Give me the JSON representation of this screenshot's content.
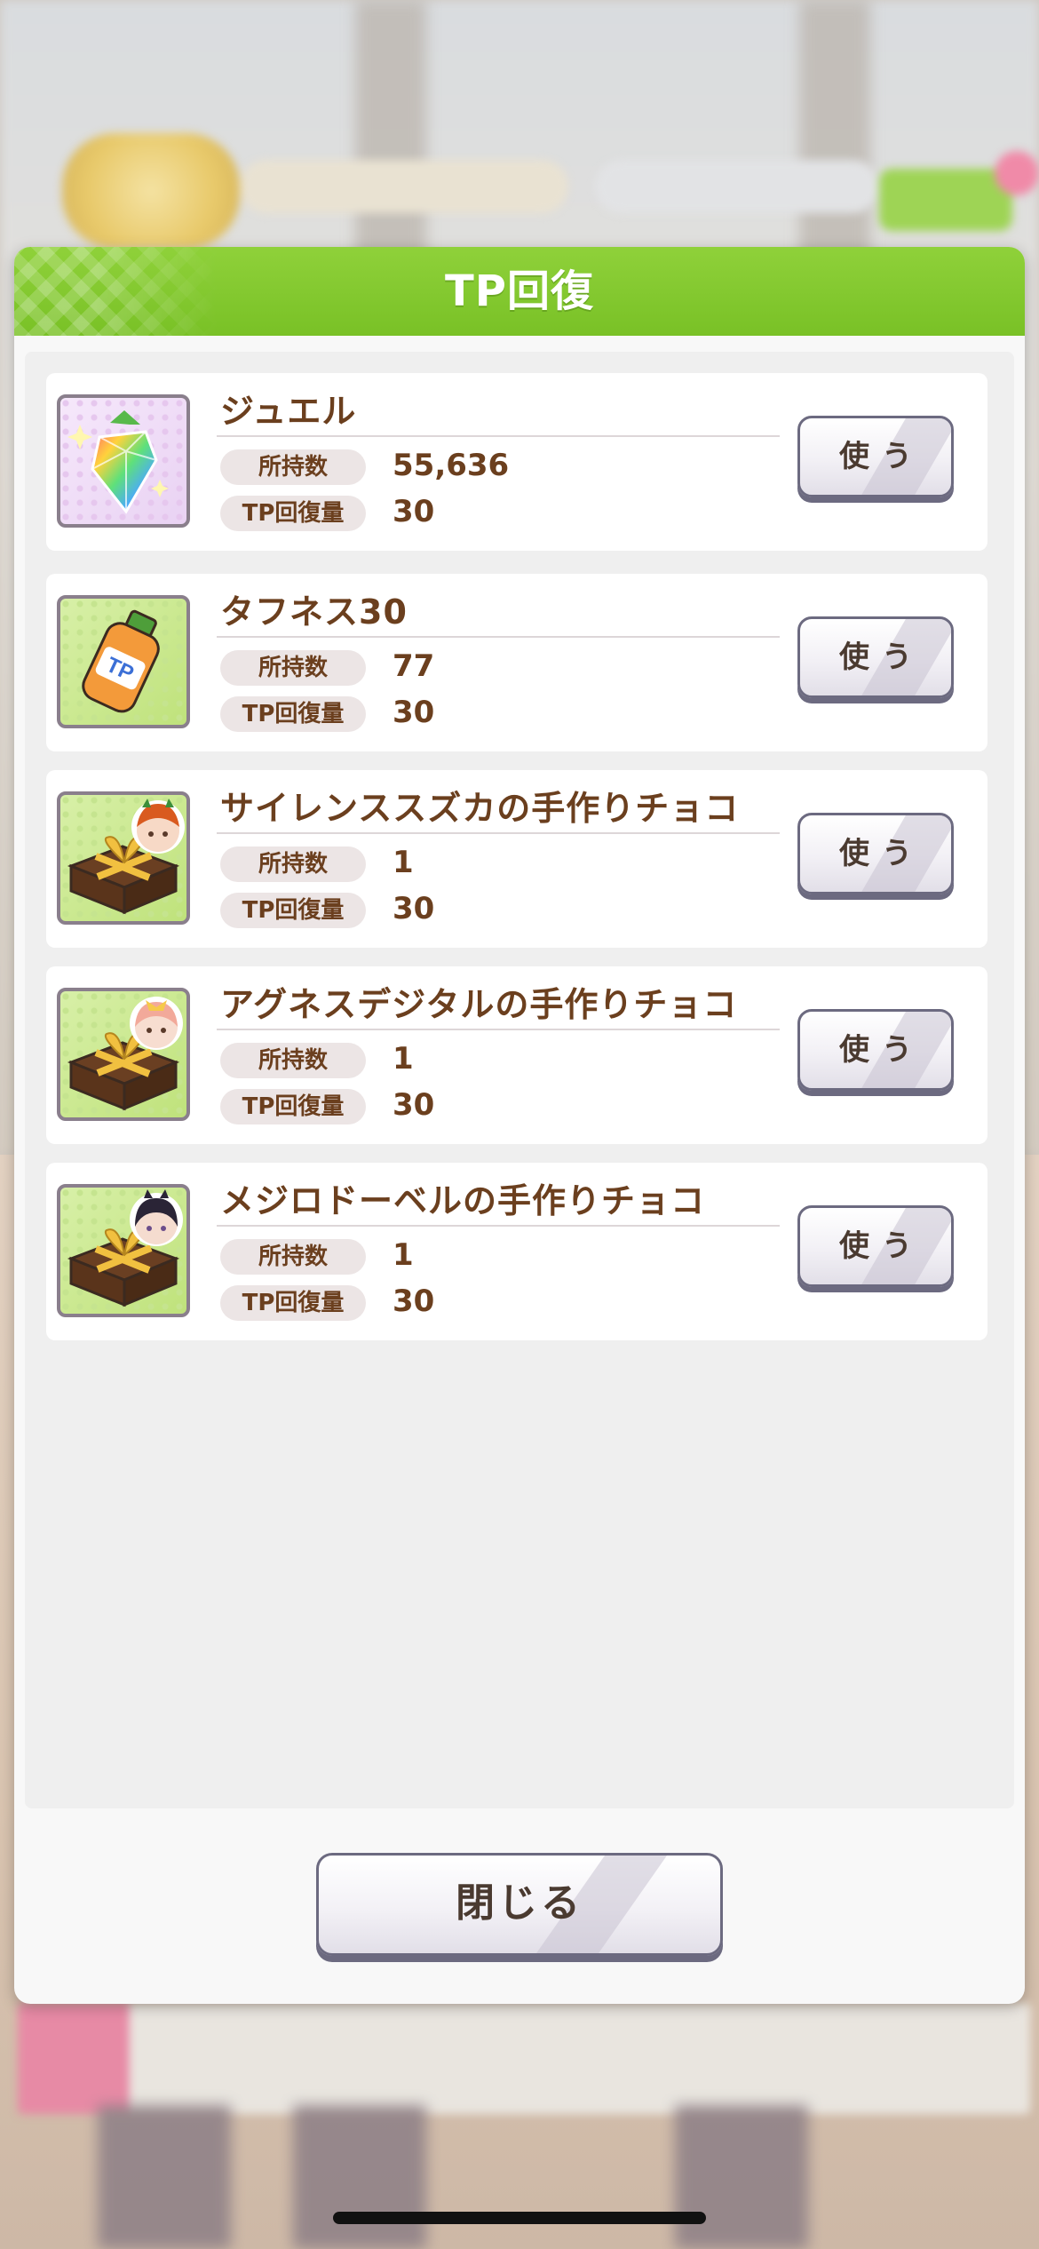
{
  "dialog": {
    "title": "TP回復",
    "close_label": "閉じる"
  },
  "labels": {
    "owned": "所持数",
    "tp_recovery": "TP回復量",
    "use": "使う"
  },
  "items": [
    {
      "name": "ジュエル",
      "owned": "55,636",
      "tp": "30",
      "icon": "jewel-icon"
    },
    {
      "name": "タフネス30",
      "owned": "77",
      "tp": "30",
      "icon": "tp-bottle-icon"
    },
    {
      "name": "サイレンススズカの手作りチョコ",
      "owned": "1",
      "tp": "30",
      "icon": "chocolate-gift-icon"
    },
    {
      "name": "アグネスデジタルの手作りチョコ",
      "owned": "1",
      "tp": "30",
      "icon": "chocolate-gift-icon"
    },
    {
      "name": "メジロドーベルの手作りチョコ",
      "owned": "1",
      "tp": "30",
      "icon": "chocolate-gift-icon"
    }
  ],
  "colors": {
    "header_green": "#8fd13a",
    "text_brown": "#6b3f1e",
    "button_border": "#6c6a80"
  }
}
